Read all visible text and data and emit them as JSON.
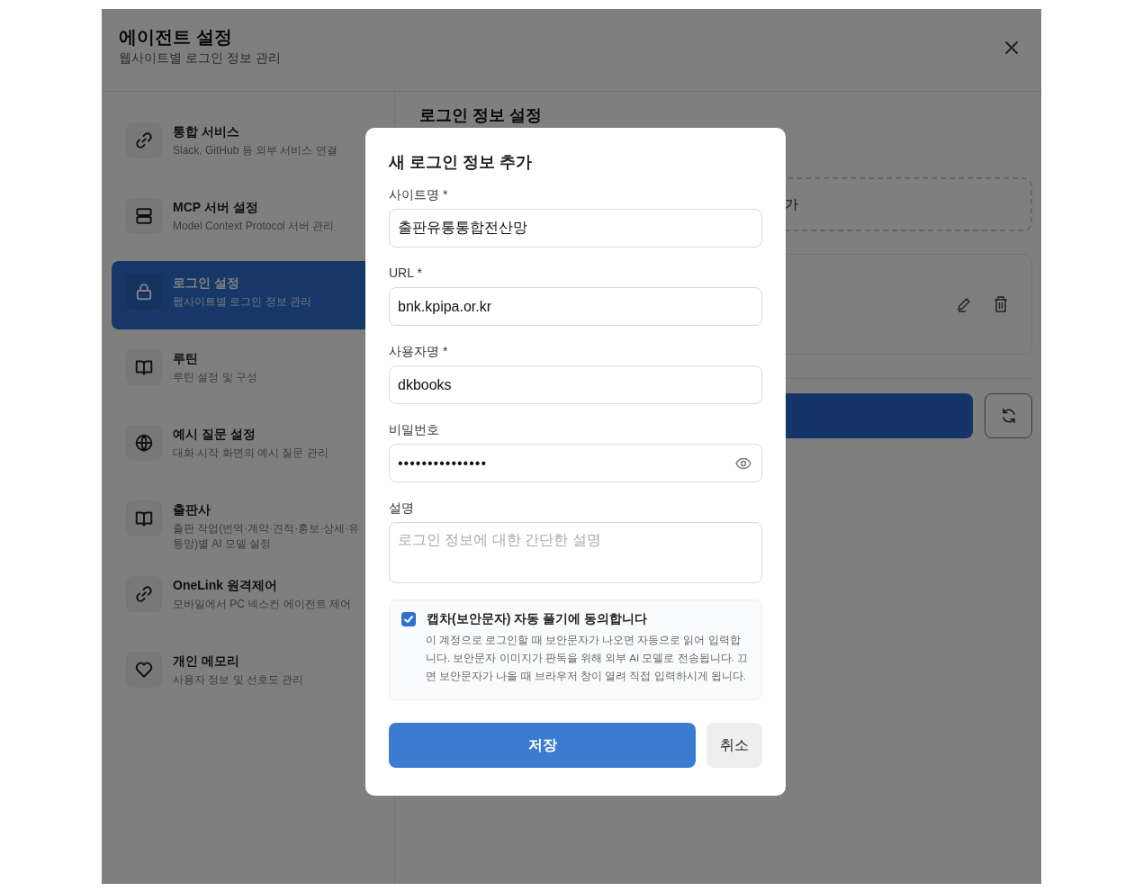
{
  "window": {
    "title": "에이전트 설정",
    "subtitle": "웹사이트별 로그인 정보 관리"
  },
  "sidebar": {
    "items": [
      {
        "title": "통합 서비스",
        "description": "Slack, GitHub 등 외부 서비스 연결",
        "selected": false
      },
      {
        "title": "MCP 서버 설정",
        "description": "Model Context Protocol 서버 관리",
        "selected": false
      },
      {
        "title": "로그인 설정",
        "description": "웹사이트별 로그인 정보 관리",
        "selected": true
      },
      {
        "title": "루틴",
        "description": "루틴 설정 및 구성",
        "selected": false
      },
      {
        "title": "예시 질문 설정",
        "description": "대화 시작 화면의 예시 질문 관리",
        "selected": false
      },
      {
        "title": "출판사",
        "description": "출판 작업(번역·계약·견적·홍보·상세·유통망)별 AI 모델 설정",
        "selected": false
      },
      {
        "title": "OneLink 원격제어",
        "description": "모바일에서 PC 넥스컨 에이전트 제어",
        "selected": false
      },
      {
        "title": "개인 메모리",
        "description": "사용자 정보 및 선호도 관리",
        "selected": false
      }
    ]
  },
  "content": {
    "heading": "로그인 정보 설정",
    "add_button": "가"
  },
  "modal": {
    "title": "새 로그인 정보 추가",
    "fields": [
      {
        "kind": "text",
        "label": "사이트명 *",
        "value": "출판유통통합전산망"
      },
      {
        "kind": "text",
        "label": "URL *",
        "value": "bnk.kpipa.or.kr"
      },
      {
        "kind": "text",
        "label": "사용자명 *",
        "value": "dkbooks"
      },
      {
        "kind": "password",
        "label": "비밀번호",
        "value": "•••••••••••••••"
      },
      {
        "kind": "textarea",
        "label": "설명",
        "placeholder": "로그인 정보에 대한 간단한 설명"
      }
    ],
    "captcha": {
      "checked": true,
      "label": "캡차(보안문자) 자동 풀기에 동의합니다",
      "description": "이 계정으로 로그인할 때 보안문자가 나오면 자동으로 읽어 입력합니다. 보안문자 이미지가 판독을 위해 외부 AI 모델로 전송됩니다. 끄면 보안문자가 나올 때 브라우저 창이 열려 직접 입력하시게 됩니다."
    },
    "buttons": {
      "save": "저장",
      "cancel": "취소"
    }
  }
}
